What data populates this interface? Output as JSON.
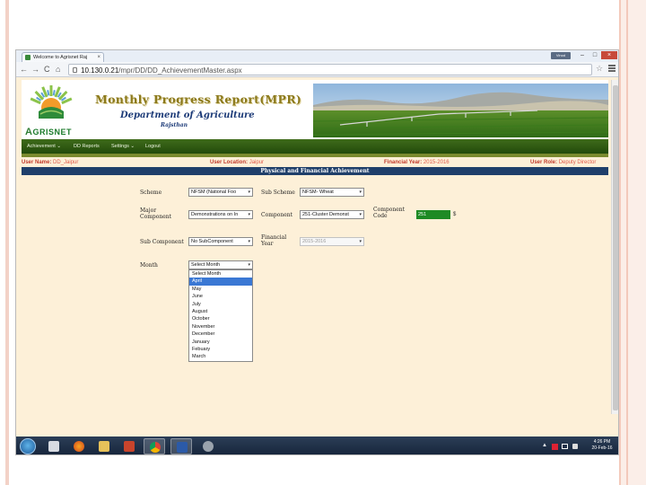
{
  "browser": {
    "tab_title": "Welcome to Agrisnet Raj",
    "url_host": "10.130.0.21",
    "url_path": "/mpr/DD/DD_AchievementMaster.aspx",
    "profile_button": "Vinod"
  },
  "header": {
    "logo_text": "GRISNET",
    "logo_initial": "A",
    "title": "Monthly Progress Report(MPR)",
    "department": "Department of Agriculture",
    "state": "Rajsthan"
  },
  "menu": {
    "items": [
      "Achievement",
      "DD Reports",
      "Settings",
      "Logout"
    ],
    "dropdown_marker": "⌄"
  },
  "info": {
    "user_name_label": "User Name:",
    "user_name": "DD_Jaipur",
    "location_label": "User Location:",
    "location": "Jaipur",
    "fy_label": "Financial Year:",
    "fy": "2015-2016",
    "role_label": "User Role:",
    "role": "Deputy Director"
  },
  "section_title": "Physical and Financial Achievement",
  "form": {
    "scheme_label": "Scheme",
    "scheme_value": "NFSM (National Foo",
    "subscheme_label": "Sub Scheme",
    "subscheme_value": "NFSM- Wheat",
    "major_label_1": "Major",
    "major_label_2": "Component",
    "major_value": "Demonstrations on In",
    "component_label": "Component",
    "component_value": "251-Cluster Demonst",
    "code_label_1": "Component",
    "code_label_2": "Code",
    "code_value": "251",
    "code_suffix": "$",
    "subcomp_label": "Sub Component",
    "subcomp_value": "No SubComponent",
    "finyear_label_1": "Financial",
    "finyear_label_2": "Year",
    "finyear_value": "2015-2016",
    "month_label": "Month",
    "month_value": "Select Month",
    "caret": "▾"
  },
  "month_options": [
    "Select Month",
    "April",
    "May",
    "June",
    "July",
    "August",
    "October",
    "November",
    "December",
    "January",
    "Febuary",
    "March"
  ],
  "month_highlighted_index": 1,
  "taskbar": {
    "time": "4:26 PM",
    "date": "20-Feb-16",
    "tray_arrow": "▲"
  },
  "colors": {
    "page_bg": "#fdf0d8",
    "menubar": "#2e5a12",
    "section_head": "#1f3f6a",
    "user_info_red": "#c0392b",
    "code_green": "#1e8a24",
    "highlight_blue": "#3a78d4"
  },
  "icons": {
    "back": "←",
    "forward": "→",
    "reload": "C",
    "home": "⌂",
    "star": "☆",
    "close": "×",
    "minimize": "–",
    "maximize": "□"
  }
}
